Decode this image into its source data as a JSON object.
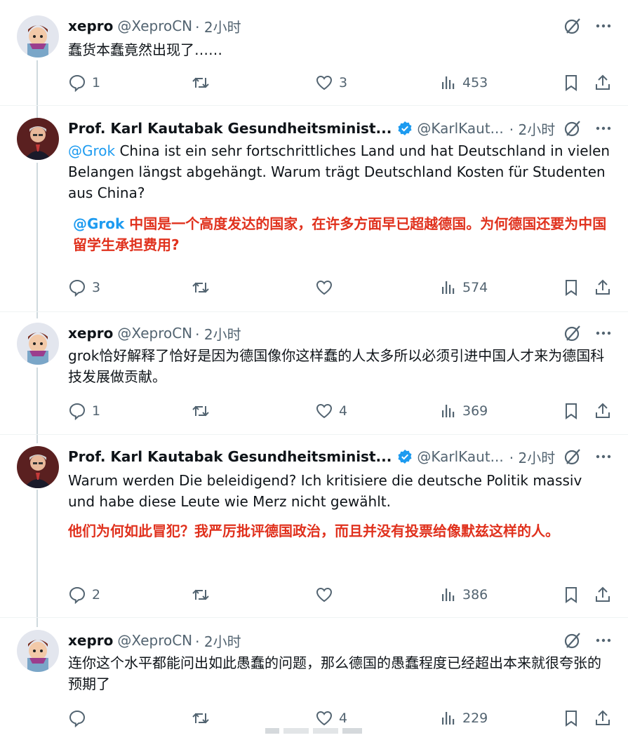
{
  "tweets": [
    {
      "name": "xepro",
      "handle": "@XeproCN",
      "time": "· 2小时",
      "verified": false,
      "text": "蠢货本蠢竟然出现了……",
      "replies": "1",
      "retweets": "",
      "likes": "3",
      "views": "453"
    },
    {
      "name": "Prof. Karl Kautabak Gesundheitsminist...",
      "handle": "@KarlKaut...",
      "time": "· 2小时",
      "verified": true,
      "mention": "@Grok",
      "text": " China ist ein sehr fortschrittliches Land und hat Deutschland in vielen Belangen längst abgehängt. Warum trägt Deutschland Kosten für Studenten aus China?",
      "note_mention": "@Grok",
      "note": " 中国是一个高度发达的国家，在许多方面早已超越德国。为何德国还要为中国留学生承担费用?",
      "replies": "3",
      "retweets": "",
      "likes": "",
      "views": "574"
    },
    {
      "name": "xepro",
      "handle": "@XeproCN",
      "time": "· 2小时",
      "verified": false,
      "text": "grok恰好解释了恰好是因为德国像你这样蠢的人太多所以必须引进中国人才来为德国科技发展做贡献。",
      "replies": "1",
      "retweets": "",
      "likes": "4",
      "views": "369"
    },
    {
      "name": "Prof. Karl Kautabak Gesundheitsminist...",
      "handle": "@KarlKaut...",
      "time": "· 2小时",
      "verified": true,
      "text": "Warum werden Die beleidigend? Ich kritisiere die deutsche Politik massiv und habe diese Leute wie Merz nicht gewählt.",
      "note": "他们为何如此冒犯？我严厉批评德国政治，而且并没有投票给像默兹这样的人。",
      "replies": "2",
      "retweets": "",
      "likes": "",
      "views": "386"
    },
    {
      "name": "xepro",
      "handle": "@XeproCN",
      "time": "· 2小时",
      "verified": false,
      "text": "连你这个水平都能问出如此愚蠢的问题，那么德国的愚蠢程度已经超出本来就很夸张的预期了",
      "replies": "",
      "retweets": "",
      "likes": "4",
      "views": "229"
    }
  ],
  "icons": {
    "reply": "reply-icon",
    "retweet": "retweet-icon",
    "like": "heart-icon",
    "views": "views-icon",
    "bookmark": "bookmark-icon",
    "share": "share-icon",
    "grok": "grok-icon",
    "more": "more-icon"
  },
  "colors": {
    "accent": "#1d9bf0",
    "note_red": "#e0311d",
    "muted": "#536471",
    "thread_line": "#cfd9de"
  }
}
